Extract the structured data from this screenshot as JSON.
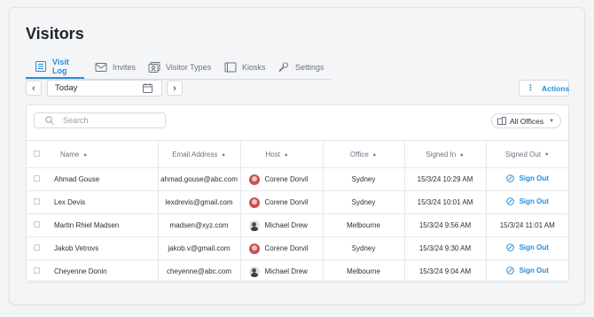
{
  "page": {
    "title": "Visitors"
  },
  "tabs": [
    {
      "label": "Visit Log",
      "icon": "list-icon",
      "active": true
    },
    {
      "label": "Invites",
      "icon": "envelope-icon",
      "active": false
    },
    {
      "label": "Visitor Types",
      "icon": "id-card-icon",
      "active": false
    },
    {
      "label": "Kiosks",
      "icon": "tablet-icon",
      "active": false
    },
    {
      "label": "Settings",
      "icon": "wrench-icon",
      "active": false
    }
  ],
  "toolbar": {
    "prev_label": "‹",
    "next_label": "›",
    "date_value": "Today",
    "actions_label": "Actions"
  },
  "filters": {
    "search_placeholder": "Search",
    "office_filter": "All Offices"
  },
  "table": {
    "columns": [
      "Name",
      "Email Address",
      "Host",
      "Office",
      "Signed In",
      "Signed Out"
    ],
    "rows": [
      {
        "name": "Ahmad Gouse",
        "email": "ahmad.gouse@abc.com",
        "host": "Corene Dorvil",
        "host_avatar": "female",
        "office": "Sydney",
        "signed_in": "15/3/24 10:29 AM",
        "signed_out": "Sign Out",
        "signed_out_is_action": true
      },
      {
        "name": "Lex Devis",
        "email": "lexdrevis@gmail.com",
        "host": "Corene Dorvil",
        "host_avatar": "female",
        "office": "Sydney",
        "signed_in": "15/3/24 10:01 AM",
        "signed_out": "Sign Out",
        "signed_out_is_action": true
      },
      {
        "name": "Martin Rhiel Madsen",
        "email": "madsen@xyz.com",
        "host": "Michael Drew",
        "host_avatar": "male",
        "office": "Melbourne",
        "signed_in": "15/3/24 9:56 AM",
        "signed_out": "15/3/24 11:01 AM",
        "signed_out_is_action": false
      },
      {
        "name": "Jakob Vetrovs",
        "email": "jakob.v@gmail.com",
        "host": "Corene Dorvil",
        "host_avatar": "female",
        "office": "Sydney",
        "signed_in": "15/3/24 9:30 AM",
        "signed_out": "Sign Out",
        "signed_out_is_action": true
      },
      {
        "name": "Cheyenne Donin",
        "email": "cheyenne@abc.com",
        "host": "Michael Drew",
        "host_avatar": "male",
        "office": "Melbourne",
        "signed_in": "15/3/24 9:04 AM",
        "signed_out": "Sign Out",
        "signed_out_is_action": true
      }
    ]
  },
  "colors": {
    "accent": "#2a8dd6",
    "text": "#2b2f36",
    "muted": "#6b7280"
  }
}
